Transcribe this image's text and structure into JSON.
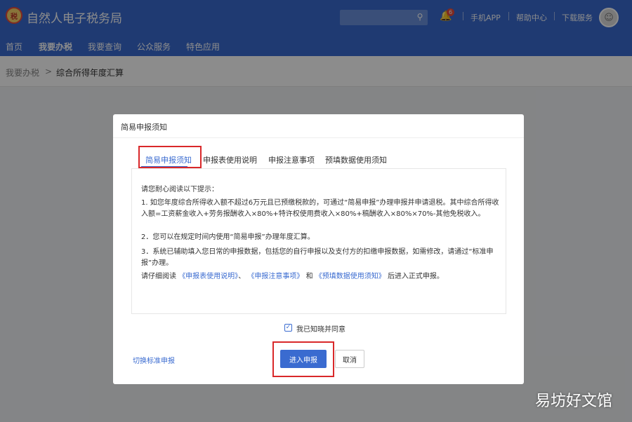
{
  "header": {
    "logo_badge": "税",
    "title": "自然人电子税务局",
    "notification_count": "6",
    "links": [
      "手机APP",
      "帮助中心",
      "下载服务"
    ]
  },
  "nav": {
    "items": [
      "首页",
      "我要办税",
      "我要查询",
      "公众服务",
      "特色应用"
    ],
    "active": "我要办税"
  },
  "breadcrumb": {
    "parent": "我要办税",
    "separator": ">",
    "current": "综合所得年度汇算"
  },
  "dialog": {
    "title": "简易申报须知",
    "tabs": [
      "简易申报须知",
      "申报表使用说明",
      "申报注意事项",
      "预填数据使用须知"
    ],
    "active_tab": "简易申报须知",
    "intro": "请您耐心阅读以下提示：",
    "item1": "1. 如您年度综合所得收入额不超过6万元且已预缴税款的，可通过“简易申报”办理申报并申请退税。其中综合所得收入额=工资薪金收入+劳务报酬收入×80%+特许权使用费收入×80%+稿酬收入×80%×70%-其他免税收入。",
    "item2": "2．您可以在规定时间内使用“简易申报”办理年度汇算。",
    "item3": "3．系统已辅助填入您日常的申报数据，包括您的自行申报以及支付方的扣缴申报数据，如需修改，请通过“标准申报”办理。",
    "read_prefix": "请仔细阅读",
    "read_link1": "《申报表使用说明》",
    "read_sep1": "、",
    "read_link2": "《申报注意事项》",
    "read_sep2": "和",
    "read_link3": "《预填数据使用须知》",
    "read_suffix": "后进入正式申报。",
    "agree_label": "我已知晓并同意",
    "agree_checked": true,
    "switch_link": "切换标准申报",
    "primary_button": "进入申报",
    "cancel_button": "取消"
  },
  "watermark": "易坊好文馆",
  "colors": {
    "brand": "#3a6bd0",
    "highlight_box": "#d9282a"
  }
}
